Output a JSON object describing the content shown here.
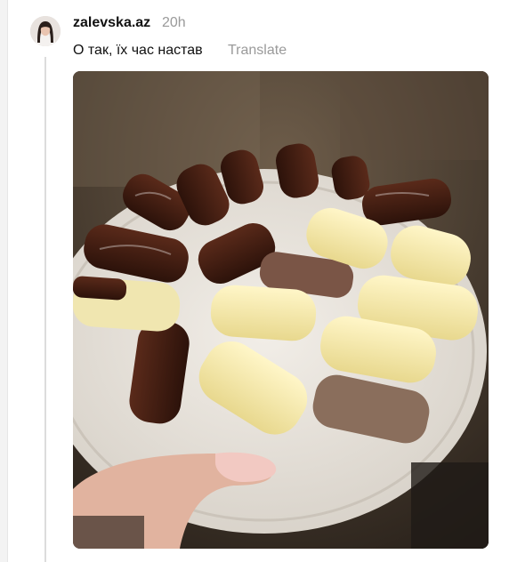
{
  "post": {
    "username": "zalevska.az",
    "timestamp": "20h",
    "text": "О так, їх час настав",
    "translate_label": "Translate"
  },
  "icons": {
    "avatar": "profile-photo",
    "media": "photo-eclairs-on-plate"
  }
}
